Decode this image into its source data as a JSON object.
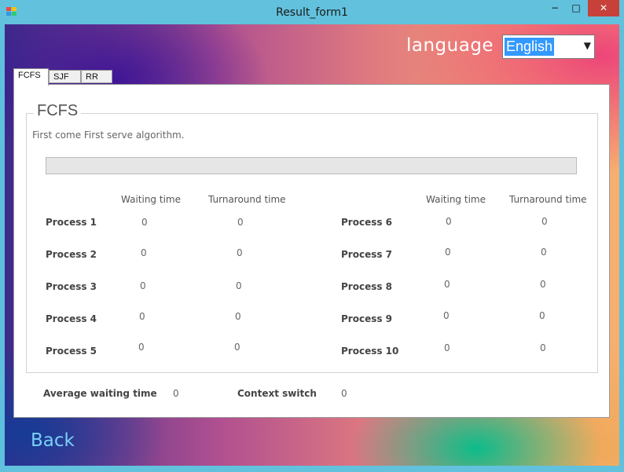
{
  "window": {
    "title": "Result_form1",
    "minimize_glyph": "−",
    "maximize_glyph": "□",
    "close_glyph": "✕",
    "app_icon": "windows-forms-icon"
  },
  "language": {
    "label": "language",
    "selected": "English"
  },
  "tabs": [
    {
      "label": "FCFS",
      "active": true
    },
    {
      "label": "SJF",
      "active": false
    },
    {
      "label": "RR",
      "active": false
    }
  ],
  "group": {
    "title": "FCFS",
    "description": "First come First serve algorithm.",
    "progress": 0
  },
  "columns": {
    "waiting": "Waiting time",
    "turnaround": "Turnaround time"
  },
  "left_processes": [
    {
      "name": "Process 1",
      "waiting": "0",
      "turnaround": "0"
    },
    {
      "name": "Process 2",
      "waiting": "0",
      "turnaround": "0"
    },
    {
      "name": "Process 3",
      "waiting": "0",
      "turnaround": "0"
    },
    {
      "name": "Process 4",
      "waiting": "0",
      "turnaround": "0"
    },
    {
      "name": "Process 5",
      "waiting": "0",
      "turnaround": "0"
    }
  ],
  "right_processes": [
    {
      "name": "Process 6",
      "waiting": "0",
      "turnaround": "0"
    },
    {
      "name": "Process 7",
      "waiting": "0",
      "turnaround": "0"
    },
    {
      "name": "Process 8",
      "waiting": "0",
      "turnaround": "0"
    },
    {
      "name": "Process 9",
      "waiting": "0",
      "turnaround": "0"
    },
    {
      "name": "Process 10",
      "waiting": "0",
      "turnaround": "0"
    }
  ],
  "summary": {
    "avg_waiting_label": "Average waiting time",
    "avg_waiting_value": "0",
    "context_switch_label": "Context switch",
    "context_switch_value": "0"
  },
  "back_label": "Back",
  "colors": {
    "titlebar": "#62c1dd",
    "close_button": "#c7413a",
    "selection": "#3399ff",
    "back_text": "#7ad0f5"
  }
}
